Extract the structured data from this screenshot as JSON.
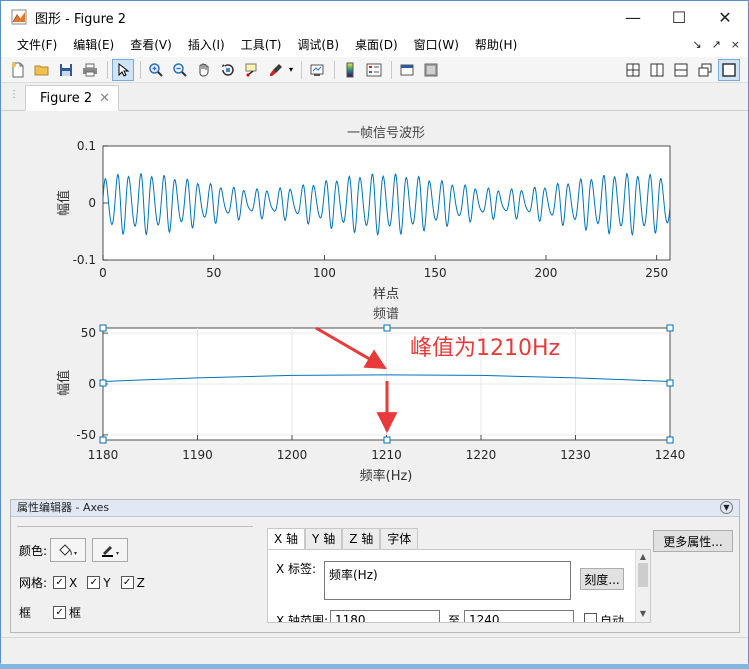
{
  "window": {
    "title": "图形 - Figure 2",
    "minimize": "—",
    "maximize": "☐",
    "close": "✕"
  },
  "menu": {
    "items": [
      "文件(F)",
      "编辑(E)",
      "查看(V)",
      "插入(I)",
      "工具(T)",
      "调试(B)",
      "桌面(D)",
      "窗口(W)",
      "帮助(H)"
    ],
    "right_glyphs": [
      "↘",
      "↗",
      "×"
    ]
  },
  "tab": {
    "label": "Figure 2",
    "close": "✕"
  },
  "charts": {
    "top": {
      "title": "一帧信号波形",
      "xlabel": "样点",
      "ylabel": "幅值"
    },
    "bottom": {
      "title": "频谱",
      "xlabel": "频率(Hz)",
      "ylabel": "幅值",
      "annotation": "峰值为1210Hz"
    }
  },
  "chart_data": [
    {
      "type": "line",
      "title": "一帧信号波形",
      "xlabel": "样点",
      "ylabel": "幅值",
      "xlim": [
        0,
        256
      ],
      "ylim": [
        -0.1,
        0.1
      ],
      "xticks": [
        "0",
        "50",
        "100",
        "150",
        "200",
        "250"
      ],
      "yticks": [
        "0.1",
        "0",
        "-0.1"
      ],
      "series": [
        {
          "description_free": true,
          "x_start": 0,
          "x_end": 256,
          "cycles": 49,
          "amplitude_min": 0.02,
          "amplitude_max": 0.048
        }
      ],
      "grid": false
    },
    {
      "type": "line",
      "title": "频谱",
      "xlabel": "频率(Hz)",
      "ylabel": "幅值",
      "xlim": [
        1180,
        1240
      ],
      "ylim": [
        -55,
        55
      ],
      "xticks": [
        "1180",
        "1190",
        "1200",
        "1210",
        "1220",
        "1230",
        "1240"
      ],
      "yticks": [
        "50",
        "0",
        "-50"
      ],
      "series": [
        {
          "x": [
            1180,
            1190,
            1200,
            1210,
            1220,
            1230,
            1240
          ],
          "y": [
            2.5,
            6,
            8.5,
            9,
            8.5,
            6,
            2.5
          ]
        }
      ],
      "annotation": "峰值为1210Hz",
      "annotation_x": 1210,
      "grid": true
    }
  ],
  "property_editor": {
    "header": "属性编辑器 - Axes",
    "color_label": "颜色:",
    "grid_label": "网格:",
    "grid_x": "X",
    "grid_y": "Y",
    "grid_z": "Z",
    "box_label": "框",
    "box_check_label": "框",
    "tabs": [
      "X 轴",
      "Y 轴",
      "Z 轴",
      "字体"
    ],
    "x_label_caption": "X 标签:",
    "x_label_value": "频率(Hz)",
    "ticks_button": "刻度...",
    "x_range_caption": "X 轴范围:",
    "x_range_from": "1180",
    "x_range_to_caption": "至",
    "x_range_to": "1240",
    "auto_label": "自动",
    "more_button": "更多属性..."
  }
}
